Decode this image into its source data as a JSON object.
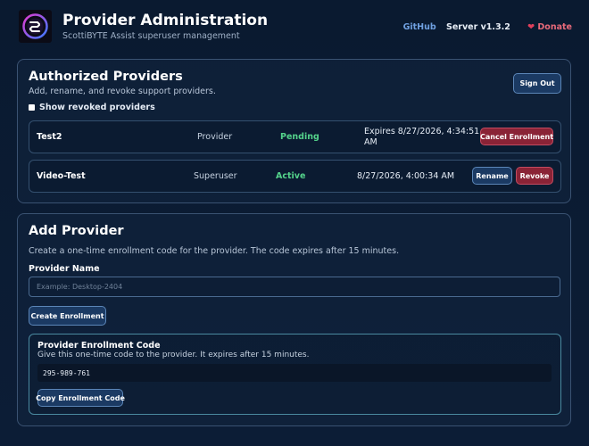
{
  "header": {
    "title": "Provider Administration",
    "subtitle": "ScottiBYTE Assist superuser management",
    "github_label": "GitHub",
    "server_version": "Server v1.3.2",
    "donate_label": "Donate",
    "donate_icon": "heart-icon",
    "logo_icon": "scottibyte-logo-icon"
  },
  "authorized": {
    "title": "Authorized Providers",
    "description": "Add, rename, and revoke support providers.",
    "sign_out_label": "Sign Out",
    "show_revoked_label": "Show revoked providers",
    "show_revoked_checked": false,
    "providers": [
      {
        "name": "Test2",
        "role": "Provider",
        "status": "Pending",
        "expires_line1": "Expires 8/27/2026, 4:34:51",
        "expires_line2": "AM",
        "actions": [
          "Cancel Enrollment"
        ]
      },
      {
        "name": "Video-Test",
        "role": "Superuser",
        "status": "Active",
        "expires_line1": "8/27/2026, 4:00:34 AM",
        "expires_line2": "",
        "actions": [
          "Rename",
          "Revoke"
        ]
      }
    ]
  },
  "add_provider": {
    "title": "Add Provider",
    "description": "Create a one-time enrollment code for the provider. The code expires after 15 minutes.",
    "name_label": "Provider Name",
    "name_value": "",
    "name_placeholder": "Example: Desktop-2404",
    "create_label": "Create Enrollment",
    "enrollment": {
      "title": "Provider Enrollment Code",
      "description": "Give this one-time code to the provider. It expires after 15 minutes.",
      "code": "295-989-761",
      "copy_label": "Copy Enrollment Code"
    }
  },
  "colors": {
    "background": "#0b1b33",
    "accent_blue": "#1b3a63",
    "danger": "#8a2336",
    "status_green": "#54d38b",
    "link_blue": "#6fa0e0",
    "donate_red": "#e86a7a"
  }
}
